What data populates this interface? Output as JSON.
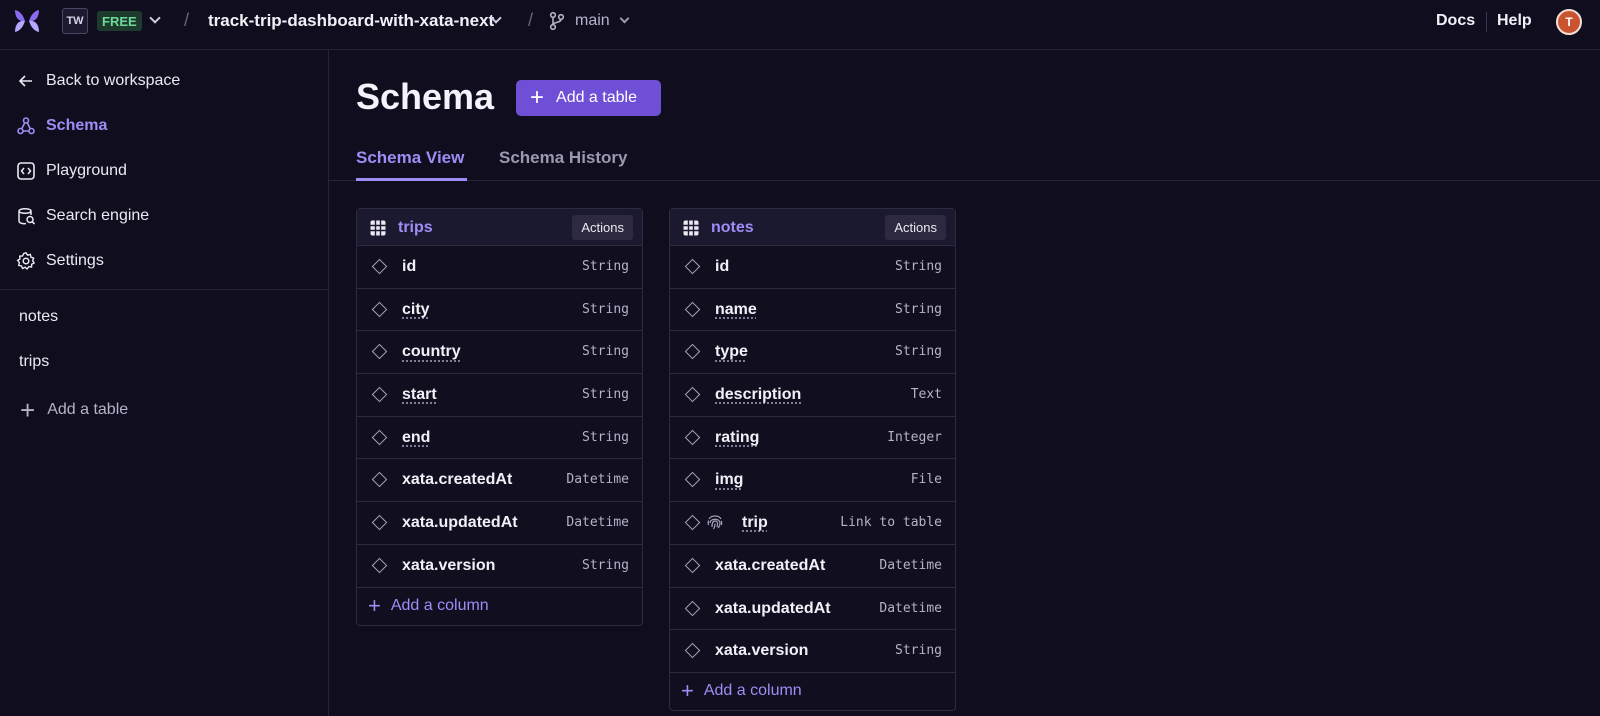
{
  "topbar": {
    "workspace_initials": "TW",
    "plan_badge": "FREE",
    "database_name": "track-trip-dashboard-with-xata-next",
    "branch_name": "main",
    "docs_label": "Docs",
    "help_label": "Help",
    "avatar_initial": "T",
    "separator": "/"
  },
  "sidebar": {
    "back_label": "Back to workspace",
    "nav": [
      {
        "label": "Schema",
        "icon": "schema-icon",
        "active": true
      },
      {
        "label": "Playground",
        "icon": "code-icon"
      },
      {
        "label": "Search engine",
        "icon": "search-engine-icon"
      },
      {
        "label": "Settings",
        "icon": "gear-icon"
      }
    ],
    "tables": [
      "notes",
      "trips"
    ],
    "add_table_label": "Add a table"
  },
  "main": {
    "title": "Schema",
    "add_table_button": "Add a table",
    "tabs": [
      {
        "label": "Schema View",
        "active": true
      },
      {
        "label": "Schema History",
        "active": false
      }
    ]
  },
  "schema_tables": [
    {
      "name": "trips",
      "actions_label": "Actions",
      "add_column_label": "Add a column",
      "columns": [
        {
          "name": "id",
          "type": "String"
        },
        {
          "name": "city",
          "type": "String"
        },
        {
          "name": "country",
          "type": "String"
        },
        {
          "name": "start",
          "type": "String"
        },
        {
          "name": "end",
          "type": "String"
        },
        {
          "name": "xata.createdAt",
          "type": "Datetime"
        },
        {
          "name": "xata.updatedAt",
          "type": "Datetime"
        },
        {
          "name": "xata.version",
          "type": "String"
        }
      ]
    },
    {
      "name": "notes",
      "actions_label": "Actions",
      "add_column_label": "Add a column",
      "columns": [
        {
          "name": "id",
          "type": "String"
        },
        {
          "name": "name",
          "type": "String"
        },
        {
          "name": "type",
          "type": "String"
        },
        {
          "name": "description",
          "type": "Text"
        },
        {
          "name": "rating",
          "type": "Integer"
        },
        {
          "name": "img",
          "type": "File"
        },
        {
          "name": "trip",
          "type": "Link to table"
        },
        {
          "name": "xata.createdAt",
          "type": "Datetime"
        },
        {
          "name": "xata.updatedAt",
          "type": "Datetime"
        },
        {
          "name": "xata.version",
          "type": "String"
        }
      ]
    }
  ],
  "colors": {
    "accent": "#a08cf5",
    "button": "#6e4fd6",
    "background": "#0f0d1e"
  }
}
